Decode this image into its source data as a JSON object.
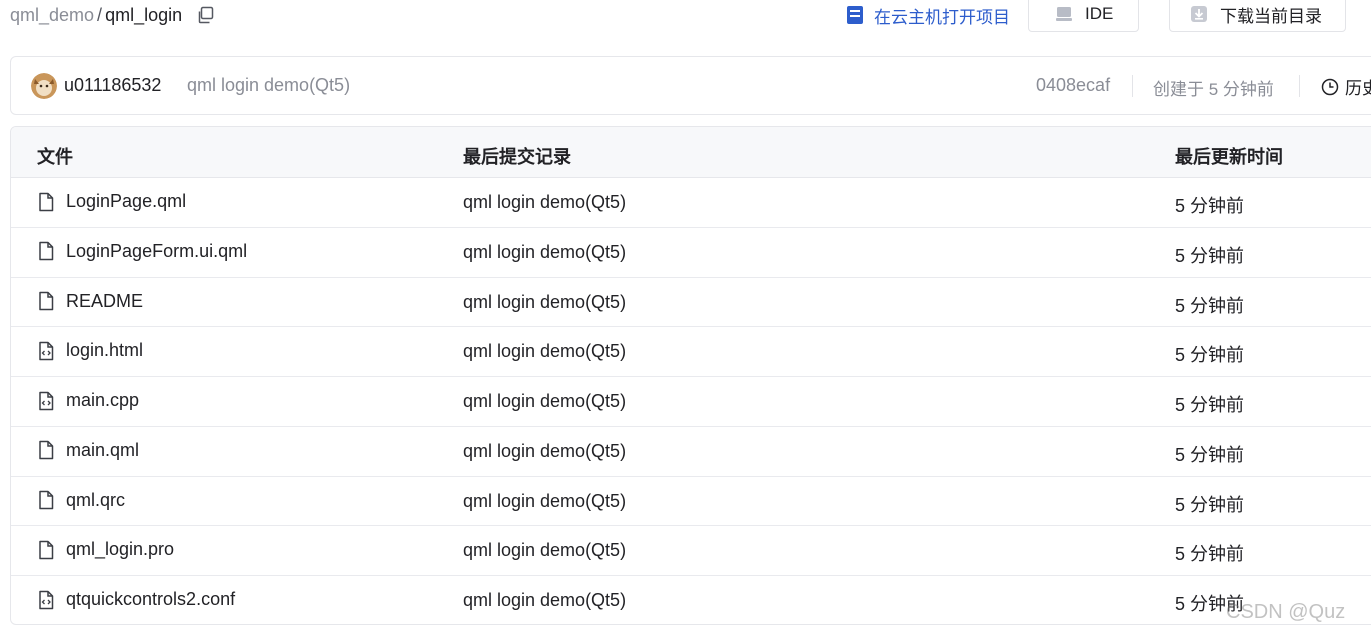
{
  "breadcrumb": {
    "owner": "qml_demo",
    "separator": "/",
    "repo": "qml_login",
    "copy_icon": "copy-icon"
  },
  "header_actions": {
    "cloud_label": "在云主机打开项目",
    "ide_label": "IDE",
    "download_label": "下载当前目录",
    "accent_color": "#2d5dcc"
  },
  "commit": {
    "user": "u011186532",
    "message": "qml login demo(Qt5)",
    "hash": "0408ecaf",
    "created": "创建于 5 分钟前",
    "history_label": "历史"
  },
  "table": {
    "headers": {
      "name": "文件",
      "commit": "最后提交记录",
      "updated": "最后更新时间"
    },
    "rows": [
      {
        "name": "LoginPage.qml",
        "icon": "file-icon",
        "commit": "qml login demo(Qt5)",
        "updated": "5 分钟前"
      },
      {
        "name": "LoginPageForm.ui.qml",
        "icon": "file-icon",
        "commit": "qml login demo(Qt5)",
        "updated": "5 分钟前"
      },
      {
        "name": "README",
        "icon": "file-icon",
        "commit": "qml login demo(Qt5)",
        "updated": "5 分钟前"
      },
      {
        "name": "login.html",
        "icon": "code-file-icon",
        "commit": "qml login demo(Qt5)",
        "updated": "5 分钟前"
      },
      {
        "name": "main.cpp",
        "icon": "code-file-icon",
        "commit": "qml login demo(Qt5)",
        "updated": "5 分钟前"
      },
      {
        "name": "main.qml",
        "icon": "file-icon",
        "commit": "qml login demo(Qt5)",
        "updated": "5 分钟前"
      },
      {
        "name": "qml.qrc",
        "icon": "file-icon",
        "commit": "qml login demo(Qt5)",
        "updated": "5 分钟前"
      },
      {
        "name": "qml_login.pro",
        "icon": "file-icon",
        "commit": "qml login demo(Qt5)",
        "updated": "5 分钟前"
      },
      {
        "name": "qtquickcontrols2.conf",
        "icon": "code-file-icon",
        "commit": "qml login demo(Qt5)",
        "updated": "5 分钟前"
      }
    ]
  },
  "watermark": "CSDN @Quz"
}
